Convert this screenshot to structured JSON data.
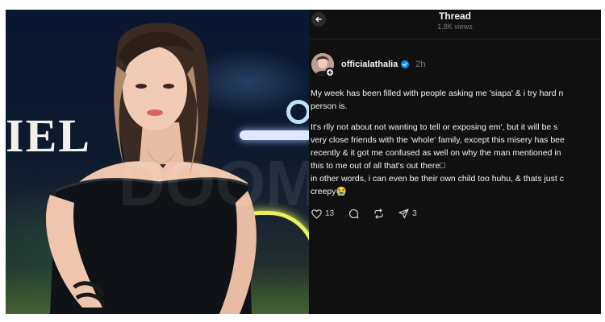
{
  "photo": {
    "sign_text": "IEL",
    "watermark": "DOOM"
  },
  "thread": {
    "title": "Thread",
    "views": "1.8K views",
    "author": {
      "username": "officialathalia",
      "verified": true,
      "timestamp": "2h"
    },
    "paragraphs": [
      [
        "My week has been filled with people asking me 'siapa' & i try hard n",
        "person is."
      ],
      [
        "It's rlly not about not wanting to tell or exposing em', but it will be s",
        "very close friends with the 'whole' family, except this misery has bee",
        "recently & it got me confused as well on why the man mentioned in",
        "this to me out of all that's out there□",
        "in other words, i can even be their own child too huhu, & thats just c",
        "creepy😭"
      ]
    ],
    "actions": {
      "likes": "13",
      "reposts_label": "",
      "shares": "3"
    }
  },
  "colors": {
    "verified": "#0095f6",
    "thread_bg": "#101010",
    "muted": "#7a7a7a"
  },
  "icons": [
    "back-arrow-icon",
    "verified-icon",
    "plus-icon",
    "heart-icon",
    "comment-icon",
    "repost-icon",
    "share-icon"
  ]
}
